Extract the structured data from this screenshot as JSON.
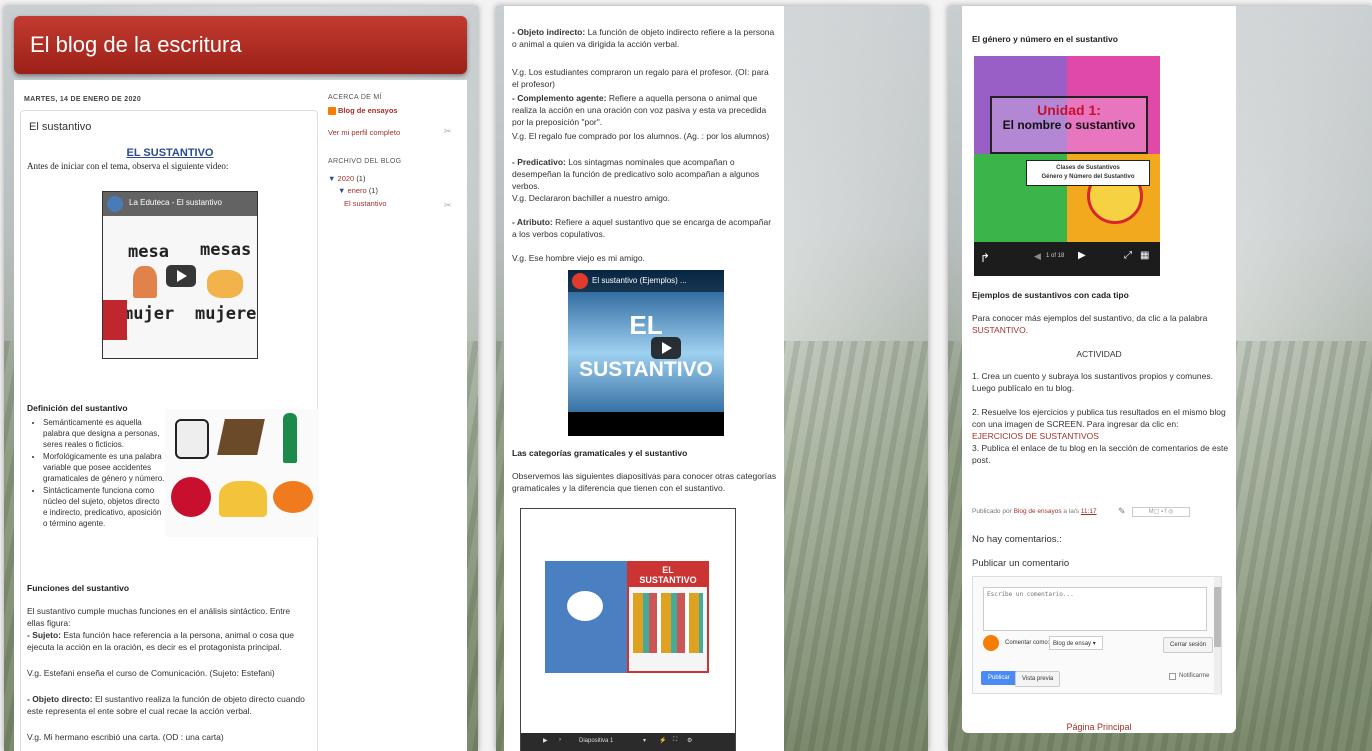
{
  "blog": {
    "title": "El blog de la escritura",
    "post_date": "MARTES, 14 DE ENERO DE 2020",
    "post_title": "El sustantivo",
    "heading": "EL SUSTANTIVO",
    "intro": "Antes de iniciar con el tema, observa el siguiente video:"
  },
  "video1": {
    "channel": "La Eduteca - El sustantivo",
    "words": [
      "mesa",
      "mesas",
      "mujer",
      "mujeres"
    ]
  },
  "sidebar": {
    "about_heading": "ACERCA DE MÍ",
    "author": "Blog de ensayos",
    "profile_link": "Ver mi perfil completo",
    "archive_heading": "ARCHIVO DEL BLOG",
    "year": "2020",
    "year_count": "(1)",
    "month": "enero",
    "month_count": "(1)",
    "post_link": "El sustantivo"
  },
  "definition": {
    "heading": "Definición del sustantivo",
    "bullets": [
      "Semánticamente es aquella palabra que designa a personas, seres reales o ficticios.",
      "Morfológicamente es una palabra variable que posee accidentes gramaticales de género y número.",
      "Sintácticamente funciona como núcleo del sujeto, objetos directo e indirecto, predicativo, aposición o término agente."
    ]
  },
  "functions": {
    "heading": "Funciones del sustantivo",
    "intro": "El sustantivo cumple muchas funciones en el análisis sintáctico. Entre ellas figura:",
    "sujeto_label": "- Sujeto:",
    "sujeto_text": " Esta función hace referencia a la persona, animal o cosa que ejecuta la acción en la oración, es decir es el protagonista principal.",
    "sujeto_example": "V.g. Estefani enseña el curso de Comunicación. (Sujeto: Estefani)",
    "od_label": "- Objeto directo:",
    "od_text": " El sustantivo realiza la función de objeto directo cuando este representa el ente sobre el cual recae la acción verbal.",
    "od_example": "V.g. Mi hermano escribió una carta.  (OD : una carta)"
  },
  "panel2": {
    "oi_label": "- Objeto indirecto:",
    "oi_text": " La función de objeto indirecto refiere a la persona o animal a quien va dirigida la acción verbal.",
    "oi_example": "V.g. Los estudiantes compraron un regalo para el profesor.  (OI: para el profesor)",
    "ca_label": "- Complemento agente:",
    "ca_text": " Refiere a aquella persona o animal que realiza la acción en una oración con voz pasiva y esta va precedida por la preposición \"por\".",
    "ca_example": "V.g. El regalo fue comprado por los alumnos. (Ag. : por los alumnos)",
    "pred_label": "- Predicativo:",
    "pred_text": " Los sintagmas nominales que acompañan o desempeñan la función de predicativo solo acompañan a algunos verbos.",
    "pred_example": "V.g. Declararon bachiller a nuestro amigo.",
    "atr_label": "- Atributo:",
    "atr_text": " Refiere a aquel sustantivo que se encarga de acompañar a los verbos copulativos.",
    "atr_example": "V.g. Ese hombre viejo es mi amigo.",
    "video2_title": "El sustantivo (Ejemplos) ...",
    "video2_big1": "EL",
    "video2_big2": "SUSTANTIVO",
    "categories_heading": "Las categorías gramaticales y el sustantivo",
    "categories_text": "Observemos las siguientes diapositivas para conocer otras categorías gramaticales y la diferencia que tienen con el sustantivo.",
    "slide_title1": "EL",
    "slide_title2": "SUSTANTIVO",
    "slide_label": "Diapositiva 1"
  },
  "panel3": {
    "gender_heading": "El género y número en el sustantivo",
    "slide_unit": "Unidad 1:",
    "slide_sub": "El nombre o sustantivo",
    "slide_small1": "Clases de Sustantivos",
    "slide_small2": "Género y Número del Sustantivo",
    "slide_counter": "1 of 18",
    "examples_heading": "Ejemplos de sustantivos con cada tipo",
    "examples_text": "Para conocer más ejemplos del sustantivo, da clic a la palabra ",
    "examples_link": "SUSTANTIVO.",
    "activity_heading": "ACTIVIDAD",
    "act1": "1. Crea un cuento y subraya los sustantivos propios y comunes. Luego publícalo en tu blog.",
    "act2_text": "2. Resuelve los ejercicios y publica tus resultados en el mismo blog con una imagen de SCREEN. Para ingresar da clic en: ",
    "act2_link": "EJERCICIOS DE SUSTANTIVOS",
    "act3": "3. Publica el enlace de tu blog en la sección de comentarios de este post.",
    "published_by": "Publicado por ",
    "published_author": "Blog de ensayos",
    "published_at": " a la/s ",
    "published_time": "11:17",
    "no_comments": "No hay comentarios.:",
    "post_comment": "Publicar un comentario",
    "comment_placeholder": "Escribe un comentario...",
    "comment_as": "Comentar como:",
    "comment_identity": "Blog de ensay",
    "logout": "Cerrar sesión",
    "publish": "Publicar",
    "preview": "Vista previa",
    "notify": "Notificarme",
    "main_page": "Página Principal"
  }
}
